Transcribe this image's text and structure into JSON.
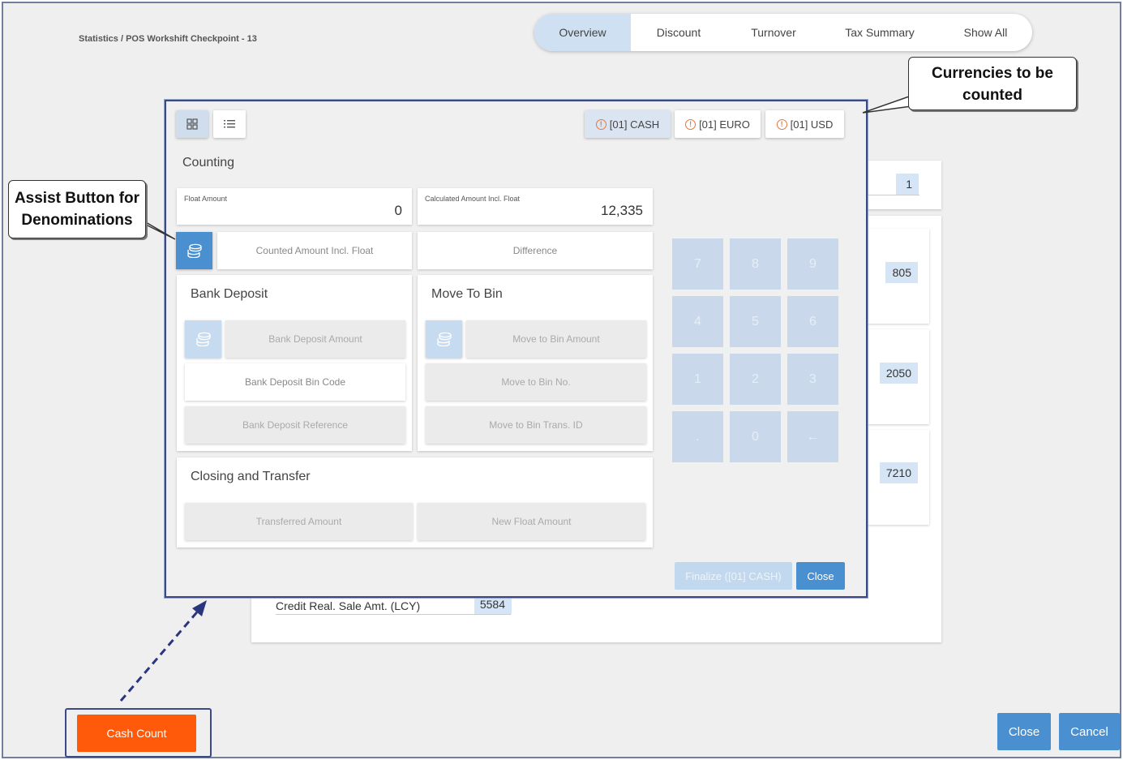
{
  "breadcrumb": "Statistics / POS Workshift Checkpoint - 13",
  "tabs": [
    {
      "label": "Overview",
      "active": true
    },
    {
      "label": "Discount",
      "active": false
    },
    {
      "label": "Turnover",
      "active": false
    },
    {
      "label": "Tax Summary",
      "active": false
    },
    {
      "label": "Show All",
      "active": false
    }
  ],
  "background": {
    "values": [
      "1",
      "805",
      "2050",
      "7210"
    ],
    "credit_row": {
      "label": "Credit Real. Sale Amt. (LCY)",
      "value": "5584"
    }
  },
  "modal": {
    "view_toggle": {
      "grid_icon": "grid-icon",
      "list_icon": "list-icon"
    },
    "currencies": [
      {
        "label": "[01] CASH",
        "active": true
      },
      {
        "label": "[01] EURO",
        "active": false
      },
      {
        "label": "[01] USD",
        "active": false
      }
    ],
    "counting": {
      "title": "Counting",
      "float_amount": {
        "label": "Float Amount",
        "value": "0"
      },
      "calculated_amount": {
        "label": "Calculated Amount Incl. Float",
        "value": "12,335"
      },
      "counted_amount_placeholder": "Counted Amount Incl. Float",
      "difference_placeholder": "Difference"
    },
    "bank_deposit": {
      "title": "Bank Deposit",
      "amount": "Bank Deposit Amount",
      "bin_code": "Bank Deposit Bin Code",
      "reference": "Bank Deposit Reference"
    },
    "move_to_bin": {
      "title": "Move To Bin",
      "amount": "Move to Bin Amount",
      "bin_no": "Move to Bin No.",
      "trans_id": "Move to Bin Trans. ID"
    },
    "closing": {
      "title": "Closing and Transfer",
      "transferred": "Transferred Amount",
      "new_float": "New Float Amount"
    },
    "keypad": [
      "7",
      "8",
      "9",
      "4",
      "5",
      "6",
      "1",
      "2",
      "3",
      ".",
      "0",
      "←"
    ],
    "finalize_label": "Finalize ([01] CASH)",
    "close_label": "Close"
  },
  "callouts": {
    "currencies": "Currencies to be counted",
    "assist_line1": "Assist Button for",
    "assist_line2": "Denominations",
    "currencies_line1": "Currencies to be",
    "currencies_line2": "counted"
  },
  "footer": {
    "cash_count": "Cash Count",
    "close": "Close",
    "cancel": "Cancel"
  },
  "colors": {
    "accent": "#4a90d0",
    "cash_count": "#ff5a0a",
    "warning": "#e8753a",
    "annotation": "#3b4a86"
  }
}
